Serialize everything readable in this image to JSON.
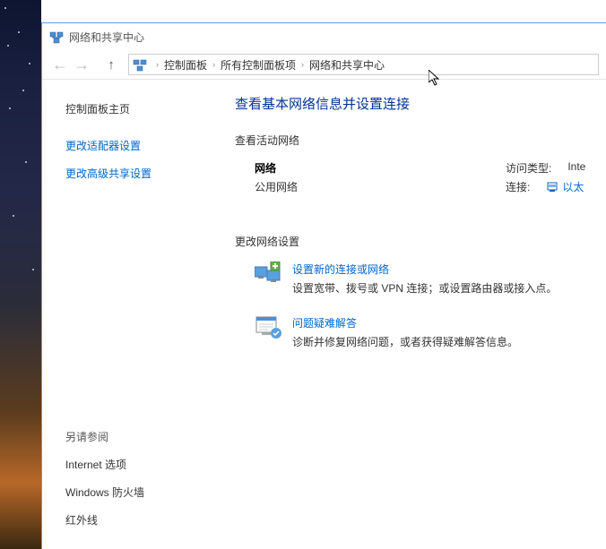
{
  "window": {
    "title": "网络和共享中心"
  },
  "breadcrumb": {
    "items": [
      "控制面板",
      "所有控制面板项",
      "网络和共享中心"
    ]
  },
  "sidebar": {
    "home": "控制面板主页",
    "links": [
      "更改适配器设置",
      "更改高级共享设置"
    ],
    "see_also_label": "另请参阅",
    "see_also": [
      "Internet 选项",
      "Windows 防火墙",
      "红外线"
    ]
  },
  "main": {
    "heading": "查看基本网络信息并设置连接",
    "active_label": "查看活动网络",
    "network": {
      "name": "网络",
      "type": "公用网络",
      "access_label": "访问类型:",
      "access_value": "Inte",
      "conn_label": "连接:",
      "conn_value": "以太"
    },
    "change_label": "更改网络设置",
    "options": [
      {
        "title": "设置新的连接或网络",
        "desc": "设置宽带、拨号或 VPN 连接；或设置路由器或接入点。"
      },
      {
        "title": "问题疑难解答",
        "desc": "诊断并修复网络问题，或者获得疑难解答信息。"
      }
    ]
  }
}
